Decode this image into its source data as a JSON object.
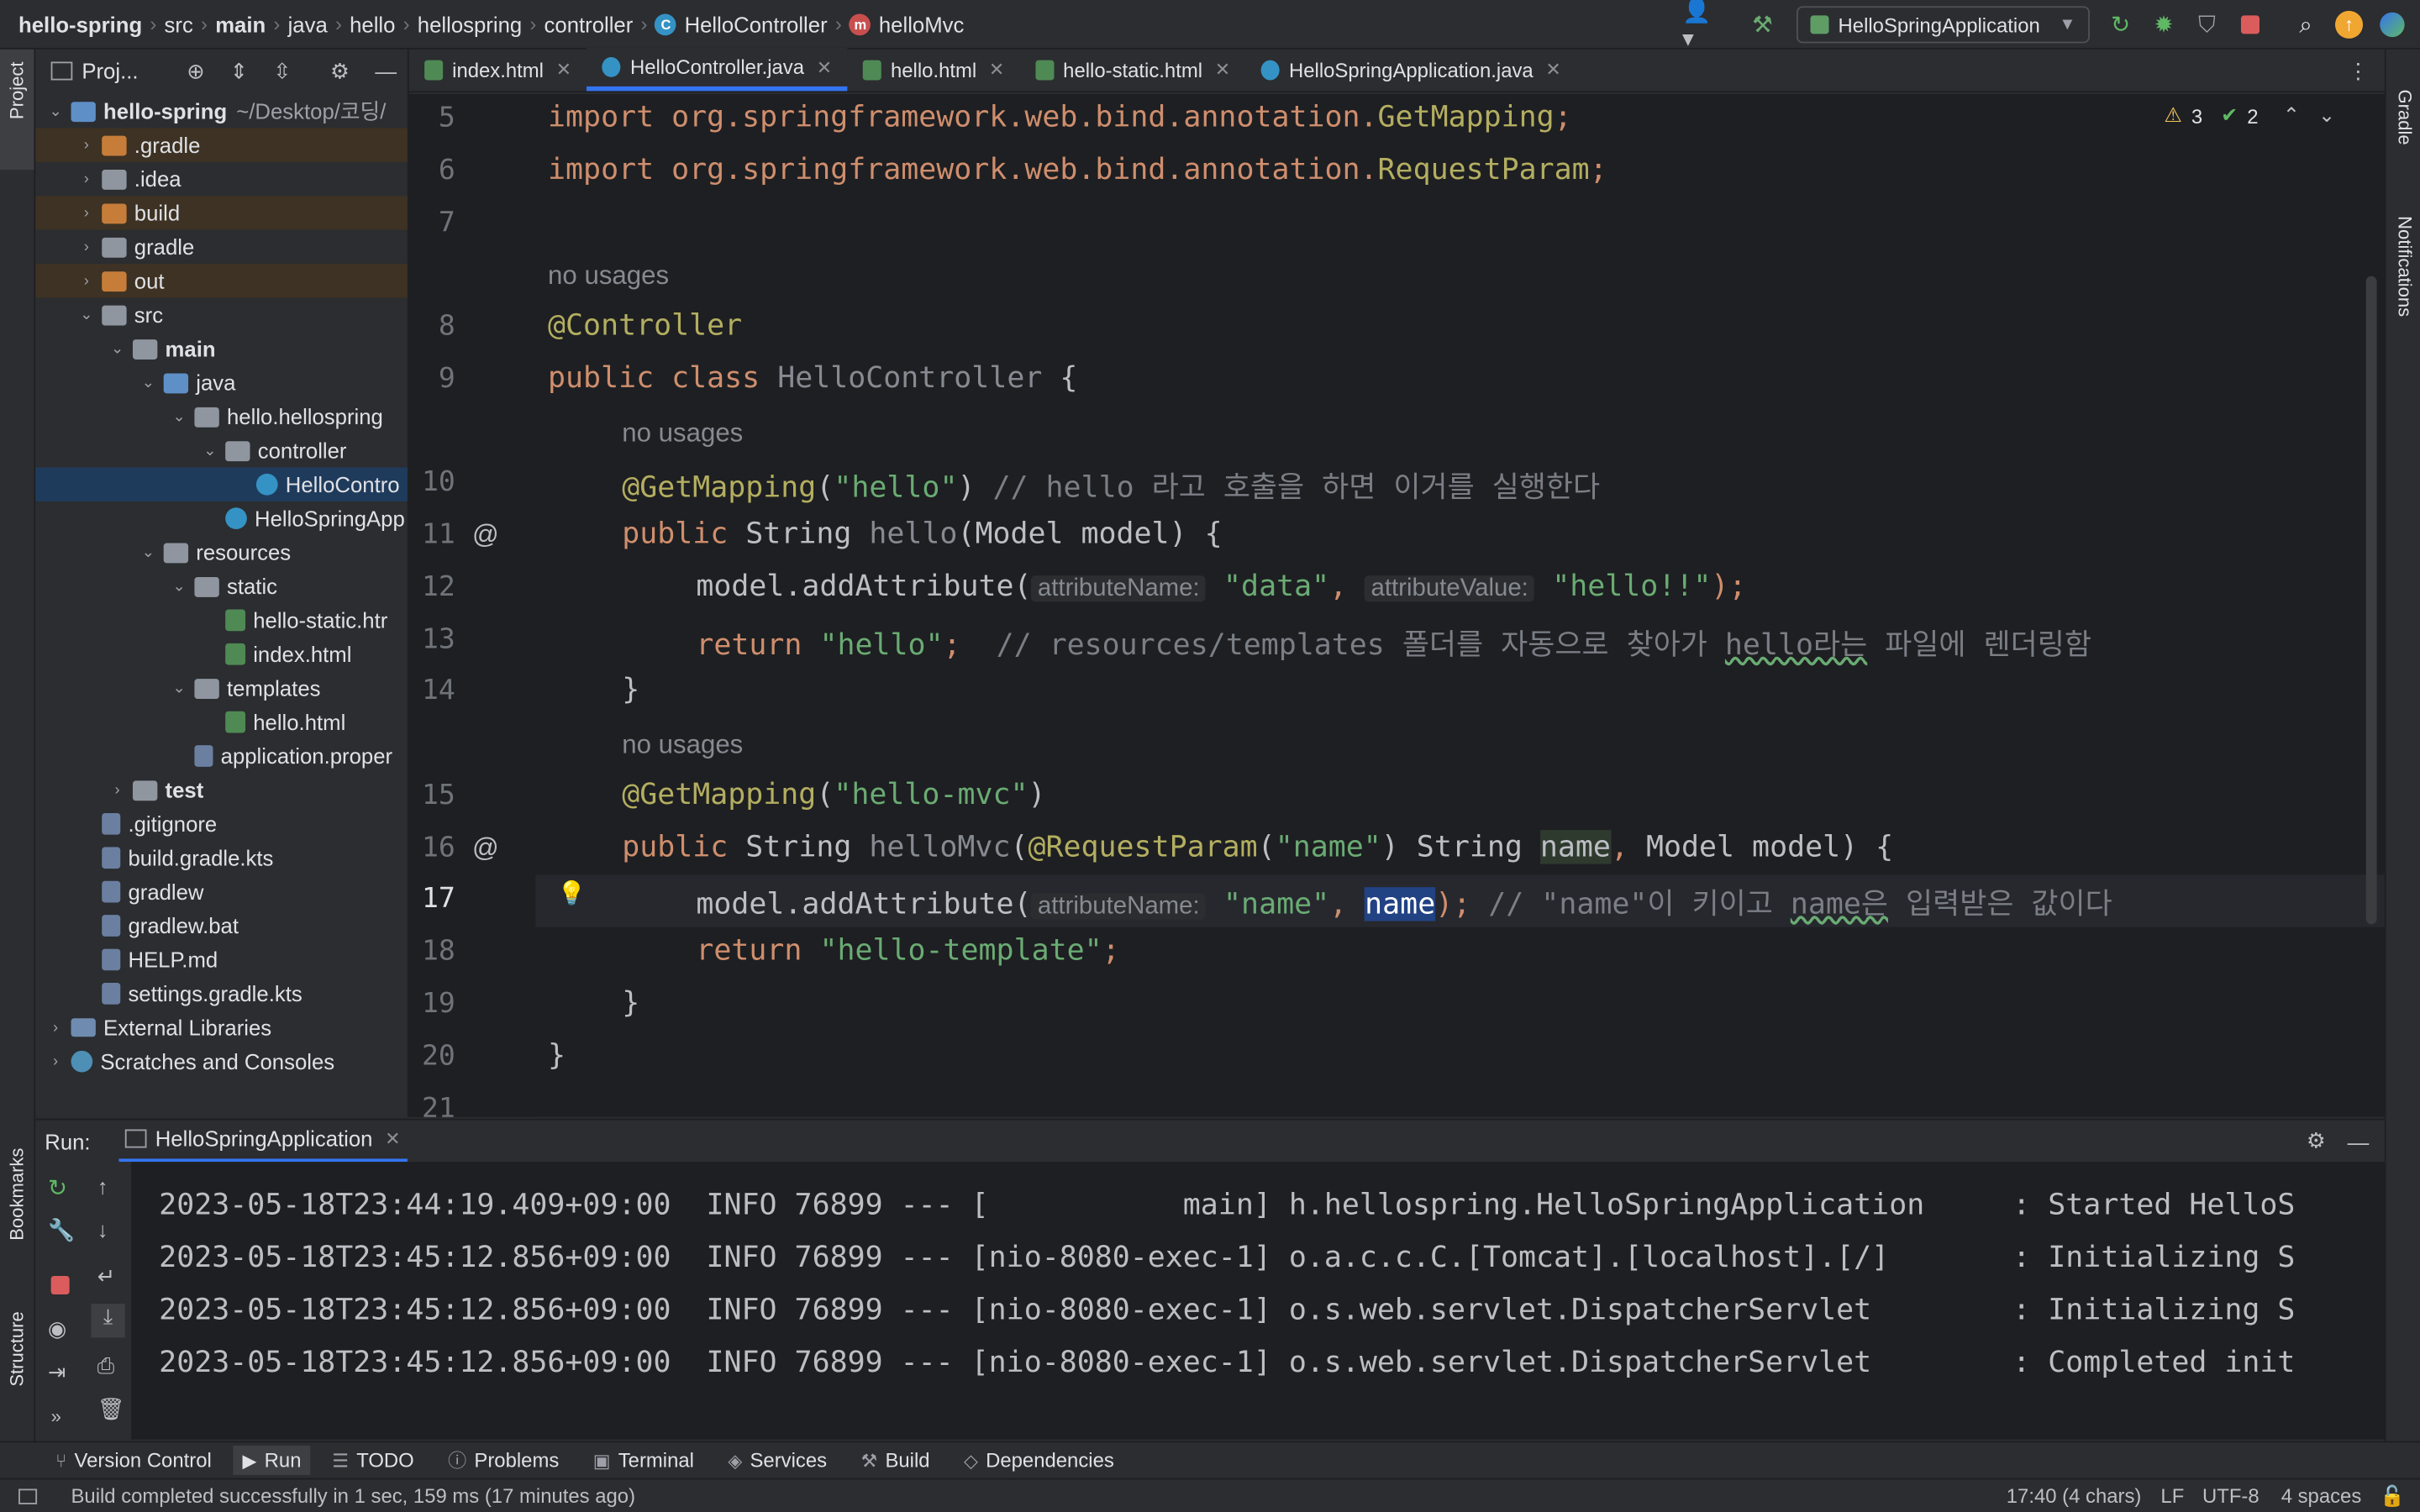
{
  "breadcrumbs": [
    "hello-spring",
    "src",
    "main",
    "java",
    "hello",
    "hellospring",
    "controller",
    "HelloController",
    "helloMvc"
  ],
  "toolbar": {
    "run_config": "HelloSpringApplication"
  },
  "project_panel": {
    "title": "Proj...",
    "root_name": "hello-spring",
    "root_path": "~/Desktop/코딩/",
    "items": [
      {
        "label": ".gradle"
      },
      {
        "label": ".idea"
      },
      {
        "label": "build"
      },
      {
        "label": "gradle"
      },
      {
        "label": "out"
      },
      {
        "label": "src"
      },
      {
        "label": "main"
      },
      {
        "label": "java"
      },
      {
        "label": "hello.hellospring"
      },
      {
        "label": "controller"
      },
      {
        "label": "HelloContro"
      },
      {
        "label": "HelloSpringApp"
      },
      {
        "label": "resources"
      },
      {
        "label": "static"
      },
      {
        "label": "hello-static.htr"
      },
      {
        "label": "index.html"
      },
      {
        "label": "templates"
      },
      {
        "label": "hello.html"
      },
      {
        "label": "application.proper"
      },
      {
        "label": "test"
      },
      {
        "label": ".gitignore"
      },
      {
        "label": "build.gradle.kts"
      },
      {
        "label": "gradlew"
      },
      {
        "label": "gradlew.bat"
      },
      {
        "label": "HELP.md"
      },
      {
        "label": "settings.gradle.kts"
      },
      {
        "label": "External Libraries"
      },
      {
        "label": "Scratches and Consoles"
      }
    ]
  },
  "tabs": [
    {
      "label": "index.html"
    },
    {
      "label": "HelloController.java"
    },
    {
      "label": "hello.html"
    },
    {
      "label": "hello-static.html"
    },
    {
      "label": "HelloSpringApplication.java"
    }
  ],
  "inspections": {
    "warnings": "3",
    "ok": "2"
  },
  "editor": {
    "line_numbers": [
      "5",
      "6",
      "7",
      "8",
      "9",
      "10",
      "11",
      "12",
      "13",
      "14",
      "15",
      "16",
      "17",
      "18",
      "19",
      "20",
      "21"
    ],
    "usage_hint": "no usages",
    "import1_prefix": "import org.springframework.web.bind.annotation.",
    "import1_class": "GetMapping",
    "import2_prefix": "import org.springframework.web.bind.annotation.",
    "import2_class": "RequestParam",
    "controller_ann": "@Controller",
    "class_decl_kw": "public class ",
    "class_name": "HelloController",
    "get_mapping": "@GetMapping",
    "hello_path": "\"hello\"",
    "hello_comment": "// hello 라고 호출을 하면 이거를 실행한다",
    "public_kw": "public ",
    "string_type": "String ",
    "hello_method": "hello",
    "hello_params": "(Model model) {",
    "add_attr": "model.addAttribute(",
    "param_attr_name": "attributeName:",
    "param_attr_value": "attributeValue:",
    "data_str": "\"data\"",
    "hello_val": "\"hello!!\"",
    "return_kw": "return ",
    "hello_str": "\"hello\"",
    "return_comment_a": "// resources/templates 폴더를 자동으로 찾아가 ",
    "return_comment_b": "hello라는",
    "return_comment_c": " 파일에 렌더링함",
    "close_brace": "}",
    "mvc_path": "\"hello-mvc\"",
    "mvc_method": "helloMvc",
    "request_param": "@RequestParam",
    "name_str": "\"name\"",
    "name_var": "name",
    "model_param": "Model model) {",
    "line17_comment_a": "// \"name\"이 키이고 ",
    "line17_comment_b": "name은",
    "line17_comment_c": " 입력받은 값이다",
    "template_str": "\"hello-template\""
  },
  "run": {
    "label": "Run:",
    "tab": "HelloSpringApplication",
    "log": [
      "2023-05-18T23:44:19.409+09:00  INFO 76899 --- [           main] h.hellospring.HelloSpringApplication     : Started HelloS",
      "2023-05-18T23:45:12.856+09:00  INFO 76899 --- [nio-8080-exec-1] o.a.c.c.C.[Tomcat].[localhost].[/]       : Initializing S",
      "2023-05-18T23:45:12.856+09:00  INFO 76899 --- [nio-8080-exec-1] o.s.web.servlet.DispatcherServlet        : Initializing S",
      "2023-05-18T23:45:12.856+09:00  INFO 76899 --- [nio-8080-exec-1] o.s.web.servlet.DispatcherServlet        : Completed init"
    ]
  },
  "tool_windows": [
    "Version Control",
    "Run",
    "TODO",
    "Problems",
    "Terminal",
    "Services",
    "Build",
    "Dependencies"
  ],
  "side_labels": {
    "project": "Project",
    "bookmarks": "Bookmarks",
    "structure": "Structure",
    "gradle": "Gradle",
    "notifications": "Notifications"
  },
  "status": {
    "message": "Build completed successfully in 1 sec, 159 ms (17 minutes ago)",
    "position": "17:40 (4 chars)",
    "line_sep": "LF",
    "encoding": "UTF-8",
    "indent": "4 spaces"
  },
  "colors": {
    "accent": "#3574f0",
    "keyword": "#cf8e6d",
    "string": "#6aab73",
    "annotation": "#b3ae60",
    "function": "#56a8f5",
    "comment": "#7a7e85"
  }
}
